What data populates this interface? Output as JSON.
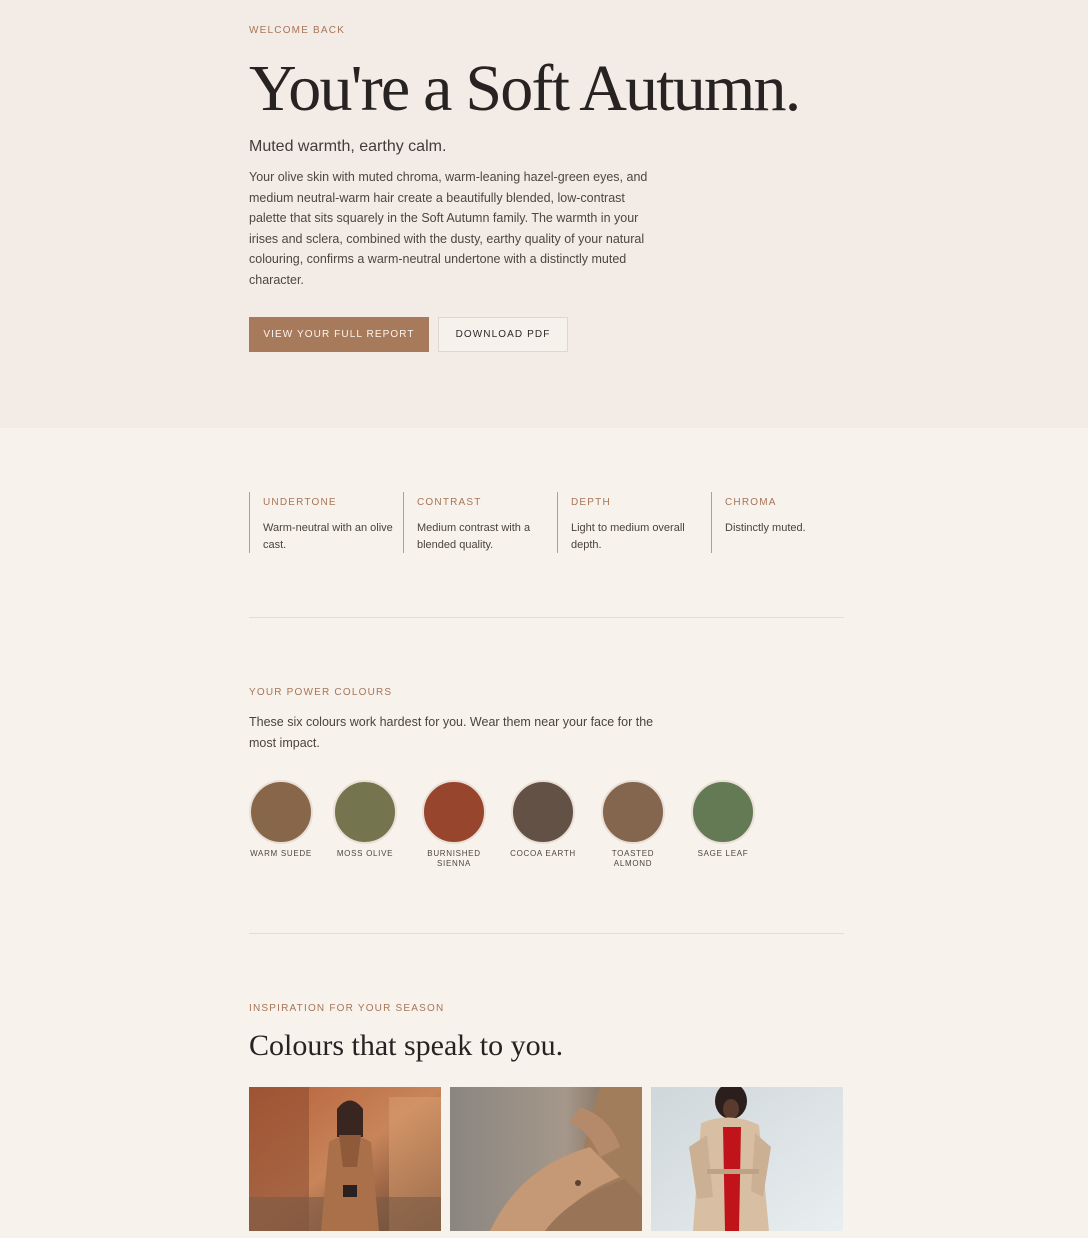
{
  "hero": {
    "eyebrow": "WELCOME BACK",
    "title": "You're a Soft Autumn.",
    "subtitle": "Muted warmth, earthy calm.",
    "body": "Your olive skin with muted chroma, warm-leaning hazel-green eyes, and medium neutral-warm hair create a beautifully blended, low-contrast palette that sits squarely in the Soft Autumn family. The warmth in your irises and sclera, combined with the dusty, earthy quality of your natural colouring, confirms a warm-neutral undertone with a distinctly muted character.",
    "primary_button": "VIEW YOUR FULL REPORT",
    "secondary_button": "DOWNLOAD PDF"
  },
  "traits": [
    {
      "label": "UNDERTONE",
      "value": "Warm-neutral with an olive cast."
    },
    {
      "label": "CONTRAST",
      "value": "Medium contrast with a blended quality."
    },
    {
      "label": "DEPTH",
      "value": "Light to medium overall depth."
    },
    {
      "label": "CHROMA",
      "value": "Distinctly muted."
    }
  ],
  "power": {
    "eyebrow": "YOUR POWER COLOURS",
    "description": "These six colours work hardest for you. Wear them near your face for the most impact.",
    "swatches": [
      {
        "name": "WARM SUEDE",
        "color": "#87664a"
      },
      {
        "name": "MOSS OLIVE",
        "color": "#74744f"
      },
      {
        "name": "BURNISHED SIENNA",
        "color": "#98452e"
      },
      {
        "name": "COCOA EARTH",
        "color": "#635146"
      },
      {
        "name": "TOASTED ALMOND",
        "color": "#83664d"
      },
      {
        "name": "SAGE LEAF",
        "color": "#647a54"
      }
    ]
  },
  "inspiration": {
    "eyebrow": "INSPIRATION FOR YOUR SEASON",
    "title": "Colours that speak to you.",
    "photos": [
      {
        "subject": "woman-in-camel-coat-street"
      },
      {
        "subject": "camel-coat-sleeve-closeup"
      },
      {
        "subject": "woman-in-beige-trench-coat"
      }
    ]
  },
  "colors": {
    "accent": "#a87a5c",
    "hero_bg": "#f3ebe5",
    "page_bg": "#f7f2ec"
  }
}
